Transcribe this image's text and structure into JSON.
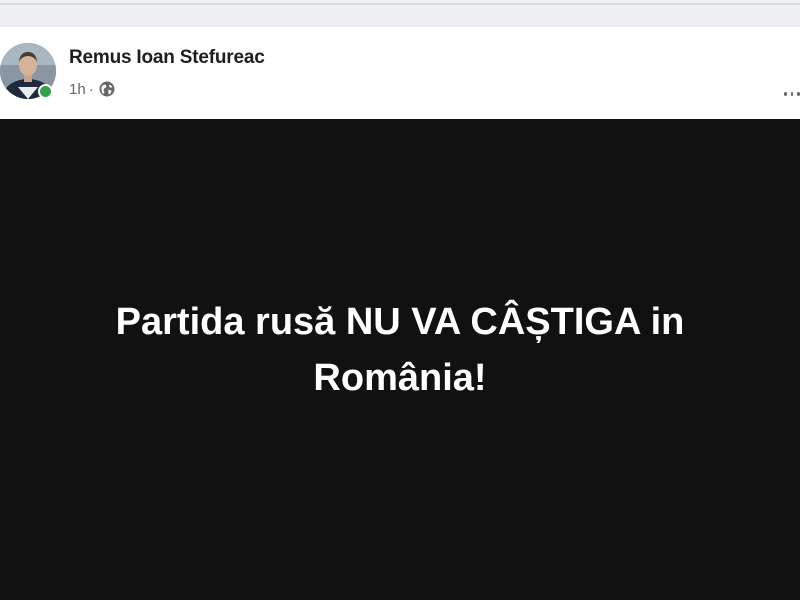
{
  "post": {
    "author_name": "Remus Ioan Stefureac",
    "timestamp": "1h",
    "separator": "·",
    "audience_icon": "globe-icon",
    "more_icon": "more-options-icon",
    "status": "online",
    "body_text": "Partida rusă NU VA CÂȘTIGA in România!",
    "body_background": "#111111",
    "body_text_color": "#ffffff"
  },
  "colors": {
    "online": "#31a24c",
    "meta": "#65676b",
    "name": "#1c1e21"
  }
}
